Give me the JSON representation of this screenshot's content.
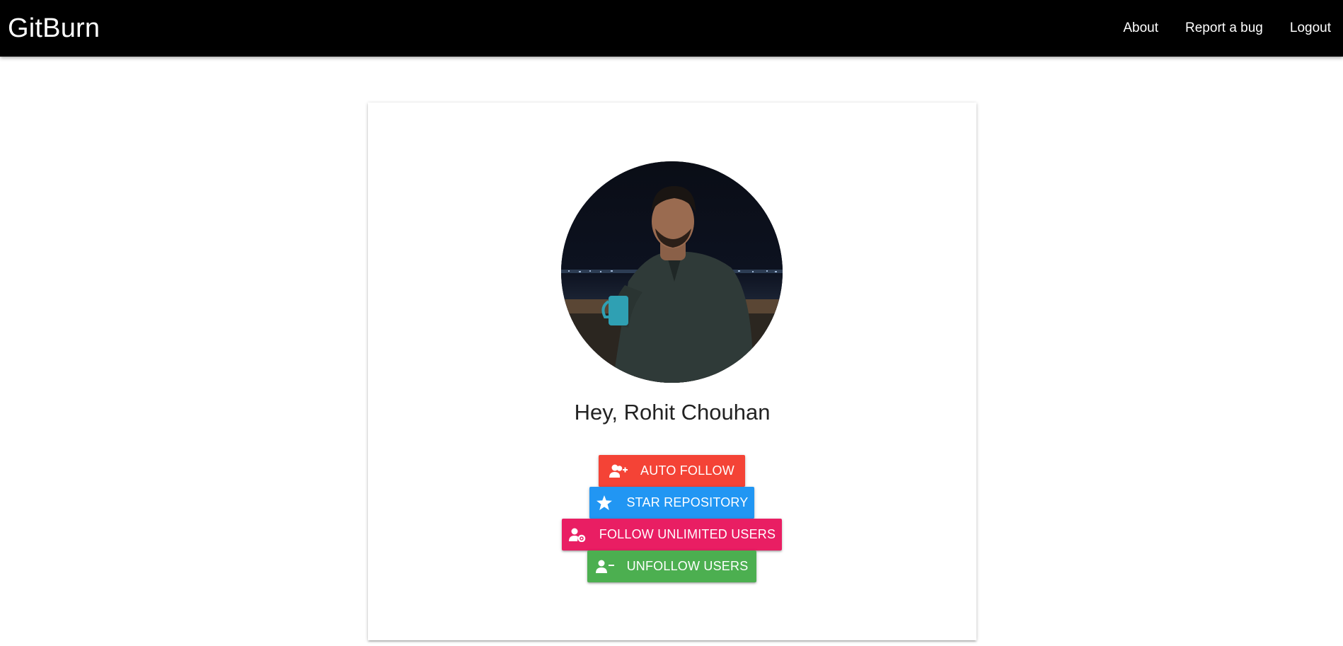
{
  "navbar": {
    "brand": "GitBurn",
    "links": [
      "About",
      "Report a bug",
      "Logout"
    ]
  },
  "profile": {
    "greeting": "Hey, Rohit Chouhan"
  },
  "actions": {
    "auto_follow": "AUTO FOLLOW",
    "star_repository": "STAR REPOSITORY",
    "follow_unlimited": "FOLLOW UNLIMITED USERS",
    "unfollow_users": "UNFOLLOW USERS"
  },
  "colors": {
    "navbar": "#000000",
    "auto_follow": "#f44336",
    "star_repository": "#2196f3",
    "follow_unlimited": "#e91e63",
    "unfollow_users": "#4caf50"
  },
  "icons": {
    "auto_follow": "user-plus-icon",
    "star_repository": "star-icon",
    "follow_unlimited": "user-cog-icon",
    "unfollow_users": "user-minus-icon"
  }
}
